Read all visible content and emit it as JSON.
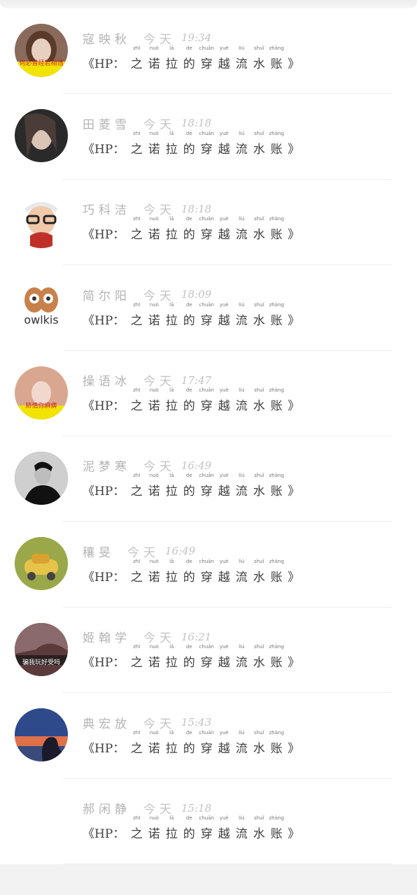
{
  "comments": [
    {
      "username": "寇映秋",
      "day": "今天",
      "time": "19:34",
      "avatar": {
        "icon": "avatar-girl-icon",
        "caption": "何必曾经若相惜",
        "colors": [
          "#8a6a5a",
          "#e8d0c0",
          "#f2e300"
        ]
      },
      "message": {
        "open": "《",
        "prefix": "HP：",
        "glyphs": [
          {
            "char": "之",
            "ruby": "zhī"
          },
          {
            "char": "诺",
            "ruby": "nuò"
          },
          {
            "char": "拉",
            "ruby": "lā"
          },
          {
            "char": "的",
            "ruby": "de"
          },
          {
            "char": "穿",
            "ruby": "chuān"
          },
          {
            "char": "越",
            "ruby": "yuè"
          },
          {
            "char": "流",
            "ruby": "liú"
          },
          {
            "char": "水",
            "ruby": "shuǐ"
          },
          {
            "char": "账",
            "ruby": "zhàng"
          }
        ],
        "close": "》"
      }
    },
    {
      "username": "田菱雪",
      "day": "今天",
      "time": "18:18",
      "avatar": {
        "icon": "avatar-woman-dark-icon",
        "caption": "",
        "colors": [
          "#2a2a2a",
          "#d9c4b6",
          "#4a3c36"
        ]
      },
      "message": {
        "open": "《",
        "prefix": "HP：",
        "glyphs": [
          {
            "char": "之",
            "ruby": "zhī"
          },
          {
            "char": "诺",
            "ruby": "nuò"
          },
          {
            "char": "拉",
            "ruby": "lā"
          },
          {
            "char": "的",
            "ruby": "de"
          },
          {
            "char": "穿",
            "ruby": "chuān"
          },
          {
            "char": "越",
            "ruby": "yuè"
          },
          {
            "char": "流",
            "ruby": "liú"
          },
          {
            "char": "水",
            "ruby": "shuǐ"
          },
          {
            "char": "账",
            "ruby": "zhàng"
          }
        ],
        "close": "》"
      }
    },
    {
      "username": "巧科洁",
      "day": "今天",
      "time": "18:18",
      "avatar": {
        "icon": "avatar-cartoon-old-man-icon",
        "caption": "",
        "colors": [
          "#ffffff",
          "#f0c9a8",
          "#c0302a"
        ]
      },
      "message": {
        "open": "《",
        "prefix": "HP：",
        "glyphs": [
          {
            "char": "之",
            "ruby": "zhī"
          },
          {
            "char": "诺",
            "ruby": "nuò"
          },
          {
            "char": "拉",
            "ruby": "lā"
          },
          {
            "char": "的",
            "ruby": "de"
          },
          {
            "char": "穿",
            "ruby": "chuān"
          },
          {
            "char": "越",
            "ruby": "yuè"
          },
          {
            "char": "流",
            "ruby": "liú"
          },
          {
            "char": "水",
            "ruby": "shuǐ"
          },
          {
            "char": "账",
            "ruby": "zhàng"
          }
        ],
        "close": "》"
      }
    },
    {
      "username": "简尔阳",
      "day": "今天",
      "time": "18:09",
      "avatar": {
        "icon": "owl-logo-icon",
        "caption": "owlkis",
        "colors": [
          "#ffffff",
          "#c8814a",
          "#333333"
        ]
      },
      "message": {
        "open": "《",
        "prefix": "HP：",
        "glyphs": [
          {
            "char": "之",
            "ruby": "zhī"
          },
          {
            "char": "诺",
            "ruby": "nuò"
          },
          {
            "char": "拉",
            "ruby": "lā"
          },
          {
            "char": "的",
            "ruby": "de"
          },
          {
            "char": "穿",
            "ruby": "chuān"
          },
          {
            "char": "越",
            "ruby": "yuè"
          },
          {
            "char": "流",
            "ruby": "liú"
          },
          {
            "char": "水",
            "ruby": "shuǐ"
          },
          {
            "char": "账",
            "ruby": "zhàng"
          }
        ],
        "close": "》"
      }
    },
    {
      "username": "操语冰",
      "day": "今天",
      "time": "17:47",
      "avatar": {
        "icon": "avatar-girl-pink-icon",
        "caption": "矫情你麻痹",
        "colors": [
          "#d9a790",
          "#f2d8cc",
          "#f2e300"
        ]
      },
      "message": {
        "open": "《",
        "prefix": "HP：",
        "glyphs": [
          {
            "char": "之",
            "ruby": "zhī"
          },
          {
            "char": "诺",
            "ruby": "nuò"
          },
          {
            "char": "拉",
            "ruby": "lā"
          },
          {
            "char": "的",
            "ruby": "de"
          },
          {
            "char": "穿",
            "ruby": "chuān"
          },
          {
            "char": "越",
            "ruby": "yuè"
          },
          {
            "char": "流",
            "ruby": "liú"
          },
          {
            "char": "水",
            "ruby": "shuǐ"
          },
          {
            "char": "账",
            "ruby": "zhàng"
          }
        ],
        "close": "》"
      }
    },
    {
      "username": "泥梦寒",
      "day": "今天",
      "time": "16:49",
      "avatar": {
        "icon": "avatar-man-bw-icon",
        "caption": "",
        "colors": [
          "#3a3a3a",
          "#bdbdbd",
          "#111111"
        ]
      },
      "message": {
        "open": "《",
        "prefix": "HP：",
        "glyphs": [
          {
            "char": "之",
            "ruby": "zhī"
          },
          {
            "char": "诺",
            "ruby": "nuò"
          },
          {
            "char": "拉",
            "ruby": "lā"
          },
          {
            "char": "的",
            "ruby": "de"
          },
          {
            "char": "穿",
            "ruby": "chuān"
          },
          {
            "char": "越",
            "ruby": "yuè"
          },
          {
            "char": "流",
            "ruby": "liú"
          },
          {
            "char": "水",
            "ruby": "shuǐ"
          },
          {
            "char": "账",
            "ruby": "zhàng"
          }
        ],
        "close": "》"
      }
    },
    {
      "username": "穰旻",
      "day": "今天",
      "time": "16:49",
      "avatar": {
        "icon": "toy-car-flowers-icon",
        "caption": "",
        "colors": [
          "#e6c44a",
          "#9aa84a",
          "#d9a230"
        ]
      },
      "message": {
        "open": "《",
        "prefix": "HP：",
        "glyphs": [
          {
            "char": "之",
            "ruby": "zhī"
          },
          {
            "char": "诺",
            "ruby": "nuò"
          },
          {
            "char": "拉",
            "ruby": "lā"
          },
          {
            "char": "的",
            "ruby": "de"
          },
          {
            "char": "穿",
            "ruby": "chuān"
          },
          {
            "char": "越",
            "ruby": "yuè"
          },
          {
            "char": "流",
            "ruby": "liú"
          },
          {
            "char": "水",
            "ruby": "shuǐ"
          },
          {
            "char": "账",
            "ruby": "zhàng"
          }
        ],
        "close": "》"
      }
    },
    {
      "username": "姬翰学",
      "day": "今天",
      "time": "16:21",
      "avatar": {
        "icon": "avatar-text-red-icon",
        "caption": "骗我玩好受吗",
        "colors": [
          "#5a3a3a",
          "#cc1f1f",
          "#2a2020"
        ]
      },
      "message": {
        "open": "《",
        "prefix": "HP：",
        "glyphs": [
          {
            "char": "之",
            "ruby": "zhī"
          },
          {
            "char": "诺",
            "ruby": "nuò"
          },
          {
            "char": "拉",
            "ruby": "lā"
          },
          {
            "char": "的",
            "ruby": "de"
          },
          {
            "char": "穿",
            "ruby": "chuān"
          },
          {
            "char": "越",
            "ruby": "yuè"
          },
          {
            "char": "流",
            "ruby": "liú"
          },
          {
            "char": "水",
            "ruby": "shuǐ"
          },
          {
            "char": "账",
            "ruby": "zhàng"
          }
        ],
        "close": "》"
      }
    },
    {
      "username": "典宏放",
      "day": "今天",
      "time": "15:43",
      "avatar": {
        "icon": "avatar-sunset-silhouette-icon",
        "caption": "",
        "colors": [
          "#2f4a8a",
          "#e0704a",
          "#1a1a2a"
        ]
      },
      "message": {
        "open": "《",
        "prefix": "HP：",
        "glyphs": [
          {
            "char": "之",
            "ruby": "zhī"
          },
          {
            "char": "诺",
            "ruby": "nuò"
          },
          {
            "char": "拉",
            "ruby": "lā"
          },
          {
            "char": "的",
            "ruby": "de"
          },
          {
            "char": "穿",
            "ruby": "chuān"
          },
          {
            "char": "越",
            "ruby": "yuè"
          },
          {
            "char": "流",
            "ruby": "liú"
          },
          {
            "char": "水",
            "ruby": "shuǐ"
          },
          {
            "char": "账",
            "ruby": "zhàng"
          }
        ],
        "close": "》"
      }
    },
    {
      "username": "郝闲静",
      "day": "今天",
      "time": "15:18",
      "avatar": {
        "icon": "calligraphy-red-text-icon",
        "caption": "",
        "colors": [
          "#ffffff",
          "#c01818",
          "#e05050"
        ]
      },
      "message": {
        "open": "《",
        "prefix": "HP：",
        "glyphs": [
          {
            "char": "之",
            "ruby": "zhī"
          },
          {
            "char": "诺",
            "ruby": "nuò"
          },
          {
            "char": "拉",
            "ruby": "lā"
          },
          {
            "char": "的",
            "ruby": "de"
          },
          {
            "char": "穿",
            "ruby": "chuān"
          },
          {
            "char": "越",
            "ruby": "yuè"
          },
          {
            "char": "流",
            "ruby": "liú"
          },
          {
            "char": "水",
            "ruby": "shuǐ"
          },
          {
            "char": "账",
            "ruby": "zhàng"
          }
        ],
        "close": "》"
      }
    }
  ]
}
